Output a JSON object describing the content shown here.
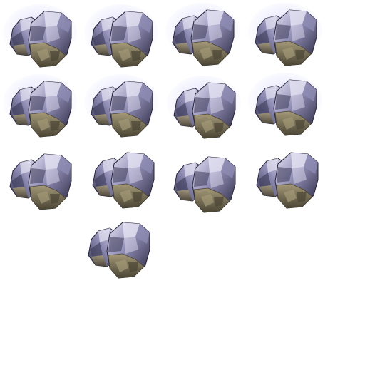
{
  "sprite_sheet": {
    "frames": [
      {
        "id": 1,
        "variant": "glow"
      },
      {
        "id": 2,
        "variant": "glow"
      },
      {
        "id": 3,
        "variant": "glow"
      },
      {
        "id": 4,
        "variant": "glow"
      },
      {
        "id": 5,
        "variant": "glow"
      },
      {
        "id": 6,
        "variant": "glow"
      },
      {
        "id": 7,
        "variant": "glow"
      },
      {
        "id": 8,
        "variant": "glow"
      },
      {
        "id": 9,
        "variant": "plain"
      },
      {
        "id": 10,
        "variant": "plain"
      },
      {
        "id": 11,
        "variant": "plain"
      },
      {
        "id": 12,
        "variant": "plain"
      },
      {
        "id": 13,
        "variant": "plain"
      }
    ],
    "colors": {
      "background": "#ffffff",
      "crystal_light": "#e4e2f2",
      "crystal_mid": "#8f8cb4",
      "crystal_dark": "#3c3a58",
      "crystal_deep": "#26243a",
      "rock_light": "#a49a78",
      "rock_dark": "#4a4434",
      "glow": "#c8c8ff"
    },
    "icon": "ore-crystal-icon"
  }
}
